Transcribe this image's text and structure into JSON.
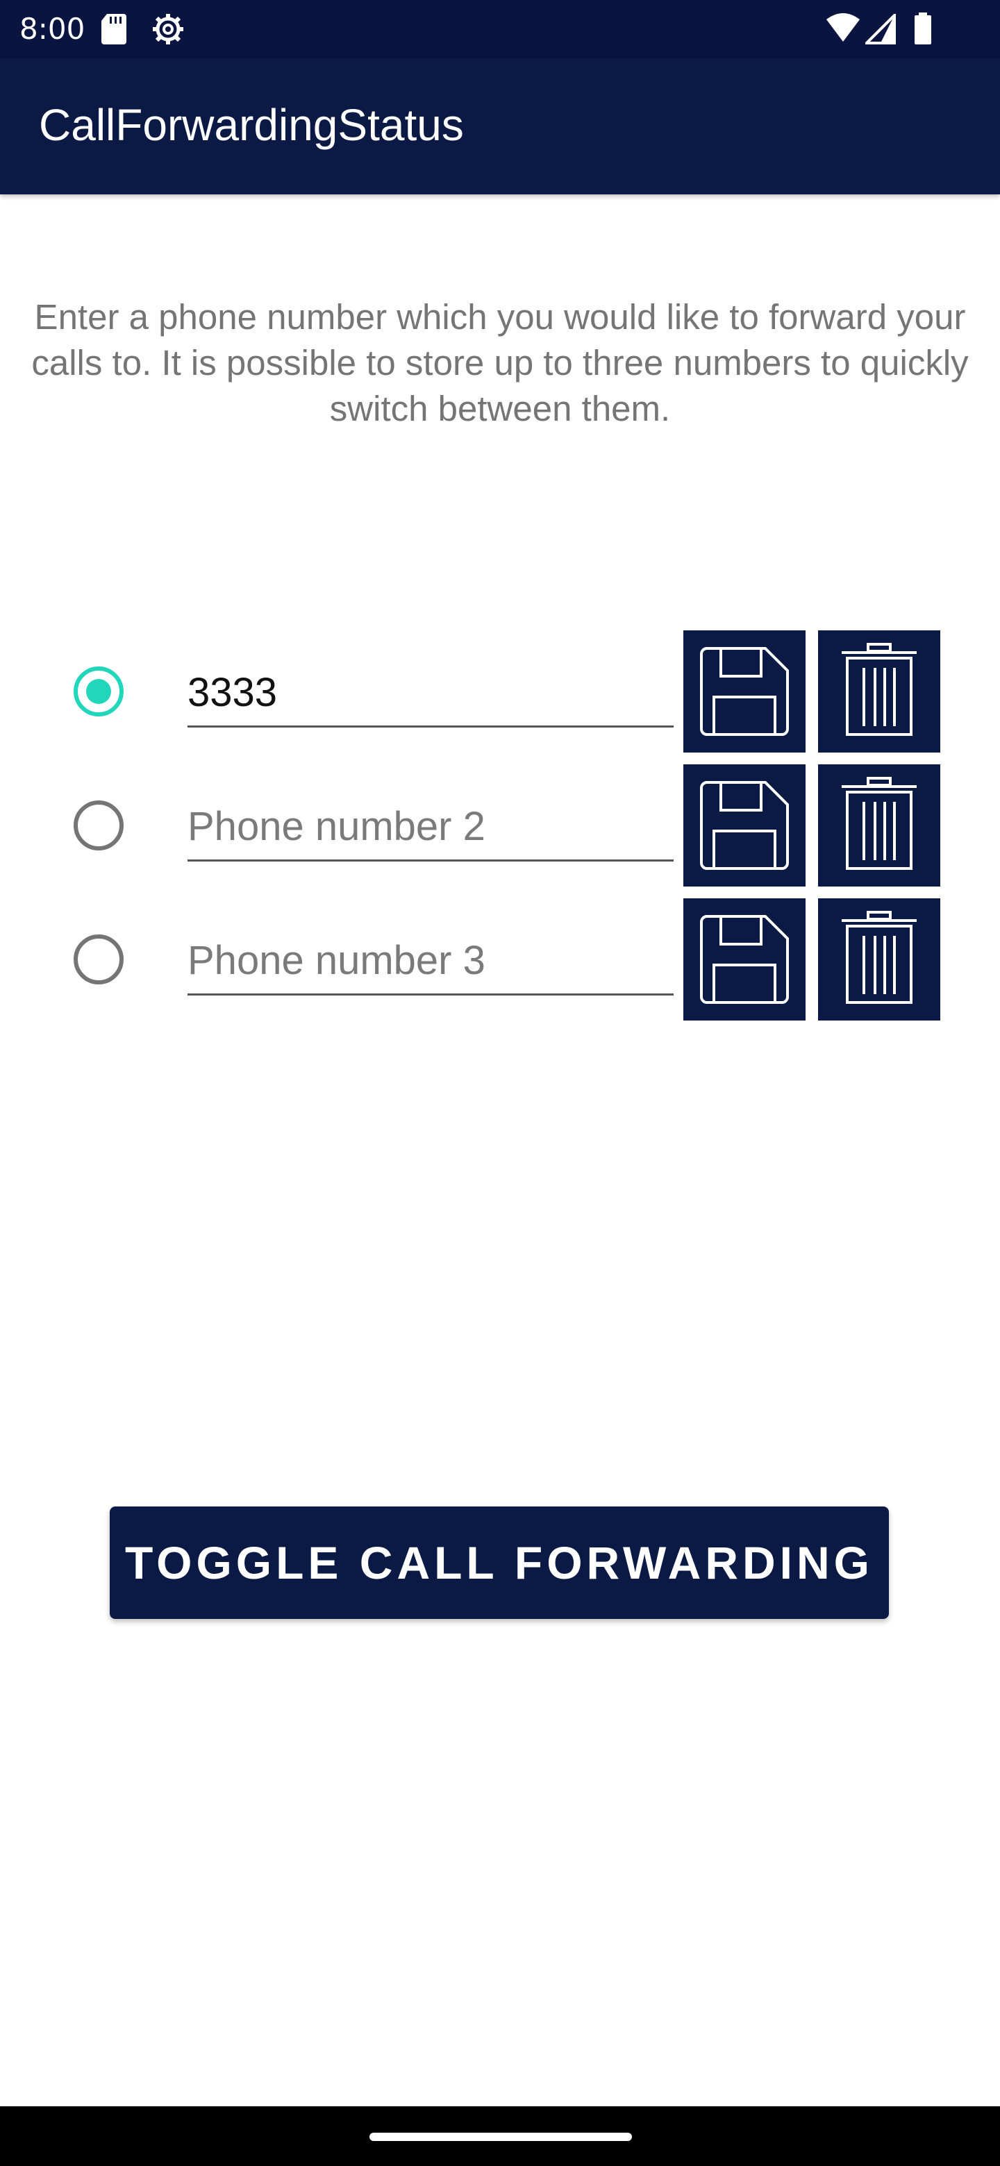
{
  "status_bar": {
    "time": "8:00",
    "icons": [
      "sd-card-icon",
      "settings-gear-icon",
      "wifi-icon",
      "signal-icon",
      "battery-icon"
    ]
  },
  "app_bar": {
    "title": "CallForwardingStatus"
  },
  "instructions": "Enter a phone number which you would like to forward your calls to. It is possible to store up to three numbers to quickly switch between them.",
  "numbers": [
    {
      "selected": true,
      "value": "3333",
      "placeholder": ""
    },
    {
      "selected": false,
      "value": "",
      "placeholder": "Phone number 2"
    },
    {
      "selected": false,
      "value": "",
      "placeholder": "Phone number 3"
    }
  ],
  "row_icons": {
    "save": "floppy-disk-icon",
    "delete": "trash-can-icon"
  },
  "toggle_button": {
    "label": "TOGGLE CALL FORWARDING"
  },
  "colors": {
    "status_bar": "#0a1440",
    "primary": "#0a1a44",
    "accent": "#22d6bb",
    "instruction_text": "#757575"
  }
}
